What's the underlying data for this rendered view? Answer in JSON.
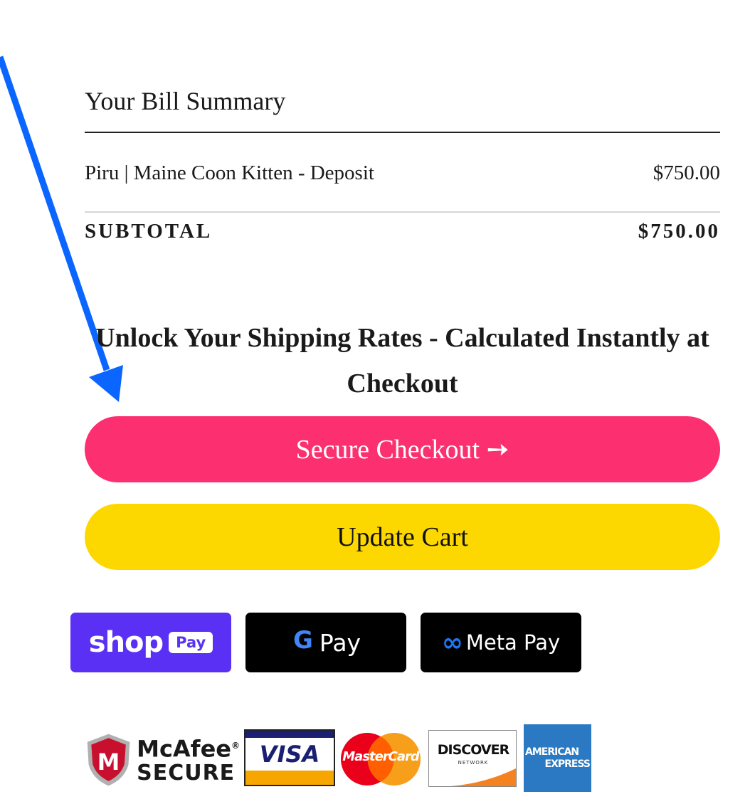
{
  "summary": {
    "title": "Your Bill Summary",
    "line_item": {
      "name": "Piru | Maine Coon Kitten - Deposit",
      "price": "$750.00"
    },
    "subtotal_label": "SUBTOTAL",
    "subtotal_value": "$750.00"
  },
  "shipping_note": "Unlock Your Shipping Rates - Calculated Instantly at Checkout",
  "buttons": {
    "checkout_label": "Secure Checkout ➙",
    "update_label": "Update Cart"
  },
  "wallets": {
    "shop_pay": {
      "brand": "shop",
      "pill": "Pay"
    },
    "google_pay": {
      "g": "G",
      "text": "Pay"
    },
    "meta_pay": {
      "symbol": "∞",
      "text": "Meta Pay"
    }
  },
  "badges": {
    "mcafee": {
      "brand": "McAfee",
      "reg": "®",
      "sub": "SECURE",
      "shield_letter": "M"
    },
    "visa": "VISA",
    "mastercard": "MasterCard",
    "discover": {
      "word": "DISCOVER",
      "network": "NETWORK"
    },
    "amex": {
      "line1": "AMERICAN",
      "line2": "EXPRESS"
    }
  },
  "colors": {
    "arrow": "#0a66ff",
    "checkout": "#fc2f70",
    "update": "#fdd800",
    "shop_pay": "#5a31f4",
    "wallet_dark": "#000000",
    "amex": "#2a79c2",
    "visa_blue": "#1a1f71",
    "visa_gold": "#f7a600",
    "mastercard_red": "#eb001b",
    "mastercard_orange": "#f79e1b",
    "discover_orange": "#f58220"
  },
  "icons": {
    "annotation_arrow": "blue-pointer-arrow-icon",
    "checkout_arrow": "right-arrow-icon",
    "google": "google-g-icon",
    "meta": "meta-infinity-icon",
    "mcafee_shield": "mcafee-shield-icon"
  }
}
